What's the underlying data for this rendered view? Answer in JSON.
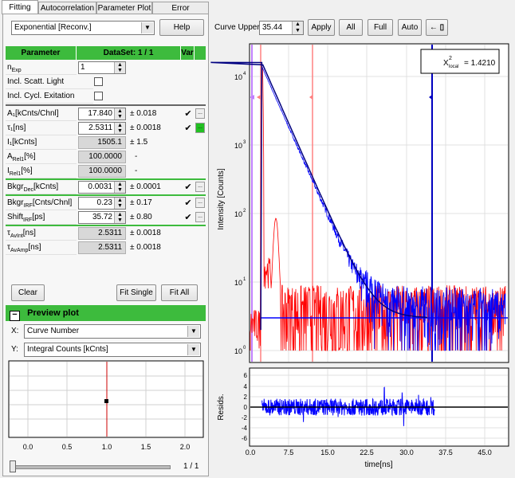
{
  "tabs": [
    "Fitting",
    "Autocorrelation",
    "Parameter Plot",
    "Error Estimation"
  ],
  "model_select": "Exponential [Reconv.]",
  "help_label": "Help",
  "table": {
    "header_param": "Parameter",
    "header_dataset": "DataSet: 1 / 1",
    "header_var": "Var",
    "nexp": {
      "label_main": "n",
      "label_sub": "Exp",
      "value": "1"
    },
    "scatt_label": "Incl. Scatt. Light",
    "cycl_label": "Incl. Cycl. Exitation",
    "a1": {
      "label": "A₁[kCnts/Chnl]",
      "value": "17.840",
      "err": "± 0.018"
    },
    "t1": {
      "label": "τ₁[ns]",
      "value": "2.5311",
      "err": "± 0.0018"
    },
    "i1": {
      "label": "I₁[kCnts]",
      "value": "1505.1",
      "err": "± 1.5"
    },
    "arel": {
      "label_main": "A",
      "label_sub": "Rel1",
      "label_unit": "[%]",
      "value": "100.0000",
      "err": "-"
    },
    "irel": {
      "label_main": "I",
      "label_sub": "Rel1",
      "label_unit": "[%]",
      "value": "100.0000",
      "err": "-"
    },
    "bkgrdec": {
      "label_main": "Bkgr",
      "label_sub": "Dec",
      "label_unit": "[kCnts]",
      "value": "0.0031",
      "err": "± 0.0001"
    },
    "bkgrirf": {
      "label_main": "Bkgr",
      "label_sub": "IRF",
      "label_unit": "[Cnts/Chnl]",
      "value": "0.23",
      "err": "± 0.17"
    },
    "shiftirf": {
      "label_main": "Shift",
      "label_sub": "IRF",
      "label_unit": "[ps]",
      "value": "35.72",
      "err": "± 0.80"
    },
    "tavint": {
      "label_main": "τ",
      "label_sub": "AvInt",
      "label_unit": "[ns]",
      "value": "2.5311",
      "err": "± 0.0018"
    },
    "tavamp": {
      "label_main": "τ",
      "label_sub": "AvAmp",
      "label_unit": "[ns]",
      "value": "2.5311",
      "err": "± 0.0018"
    },
    "tick": "✔",
    "dots": "..."
  },
  "buttons": {
    "clear": "Clear",
    "fit_single": "Fit Single",
    "fit_all": "Fit All"
  },
  "preview": {
    "title": "Preview plot",
    "collapse": "−",
    "x_label": "X:",
    "x_value": "Curve Number",
    "y_label": "Y:",
    "y_value": "Integral Counts [kCnts]",
    "x_ticks": [
      "0.0",
      "0.5",
      "1.0",
      "1.5",
      "2.0"
    ],
    "slider_value": "1 / 1"
  },
  "toolbar": {
    "curve_upper_label": "Curve Upper",
    "curve_upper_value": "35.44",
    "apply": "Apply",
    "all": "All",
    "full": "Full",
    "auto": "Auto",
    "arrow": "←",
    "box": "▯"
  },
  "decay_plot": {
    "ylabel": "Intensity [Counts]",
    "y_ticks": [
      {
        "base": "10",
        "exp": "4"
      },
      {
        "base": "10",
        "exp": "3"
      },
      {
        "base": "10",
        "exp": "2"
      },
      {
        "base": "10",
        "exp": "1"
      },
      {
        "base": "10",
        "exp": "0"
      }
    ],
    "chi_label": "X",
    "chi_sup": "2",
    "chi_sub": "local",
    "chi_value": "= 1.4210",
    "colors": {
      "irf": "#ff0000",
      "data": "#0000ff",
      "fit": "#000080",
      "marker_pink": "#ff8080",
      "marker_violet": "#c080ff",
      "marker_blue": "#0000c0"
    }
  },
  "resid_plot": {
    "ylabel": "Resids.",
    "y_ticks": [
      "6",
      "4",
      "2",
      "0",
      "-2",
      "-4",
      "-6"
    ],
    "x_ticks": [
      "0.0",
      "7.5",
      "15.0",
      "22.5",
      "30.0",
      "37.5",
      "45.0"
    ],
    "xlabel": "time[ns]"
  }
}
